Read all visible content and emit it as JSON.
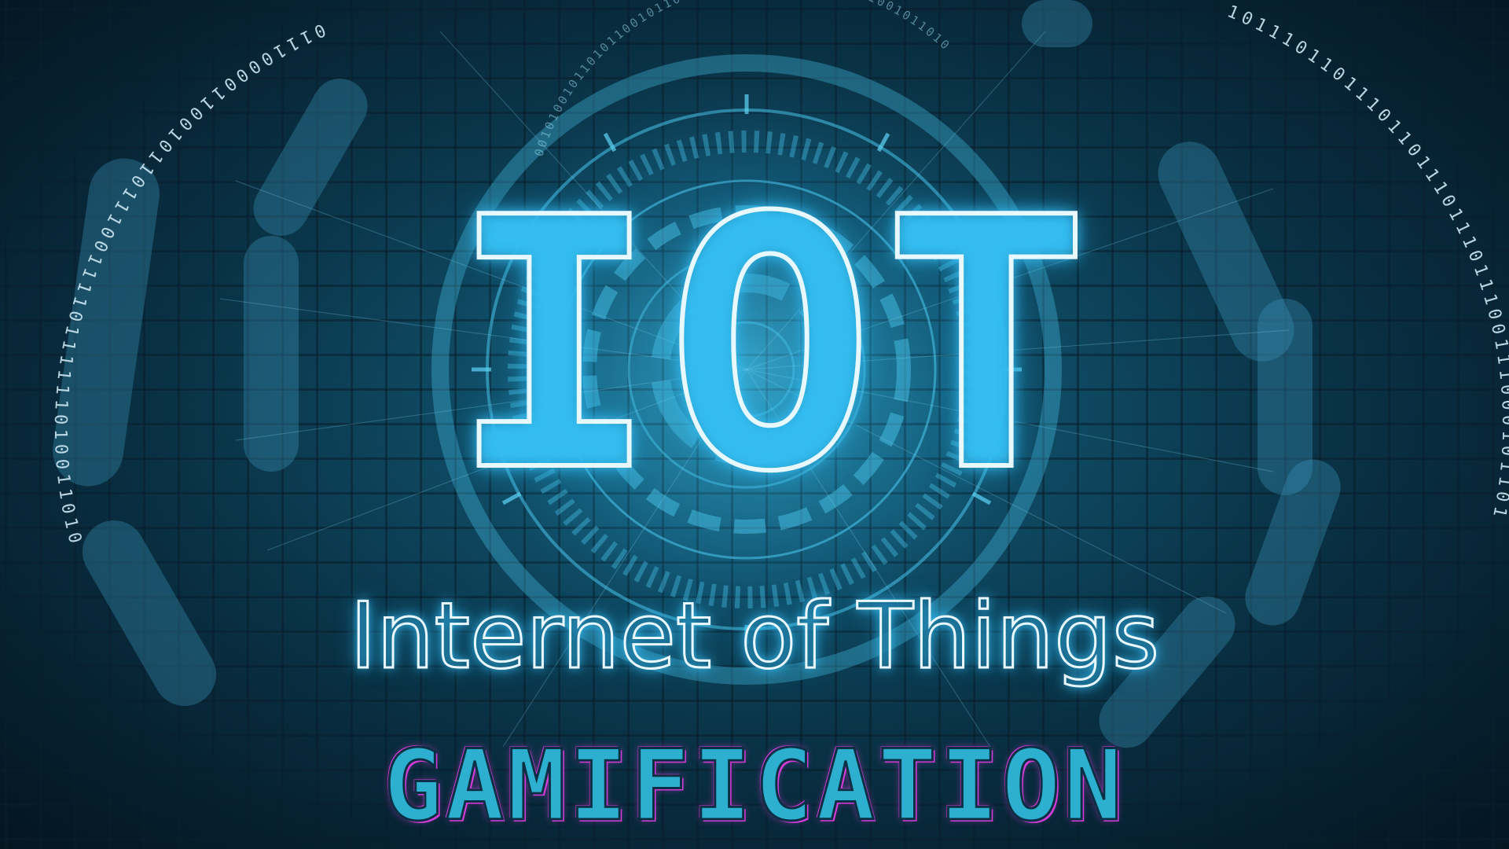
{
  "logo": {
    "acronym": "IOT",
    "subtitle": "Internet of Things"
  },
  "banner": {
    "text": "GAMIFICATION"
  },
  "binary_ring": {
    "left_text": "011100001100101101110011110111111010011010",
    "right_text": "10111011011101101110111011100111000101101",
    "inner_text": "00101001011010110010110101100100111101010011001011010"
  },
  "colors": {
    "background_dark": "#061c2a",
    "background_glow": "#1a6f8c",
    "logo_glow": "#3cc8ff",
    "banner_fill": "#2db0cf",
    "banner_outline": "#d43cd8"
  }
}
